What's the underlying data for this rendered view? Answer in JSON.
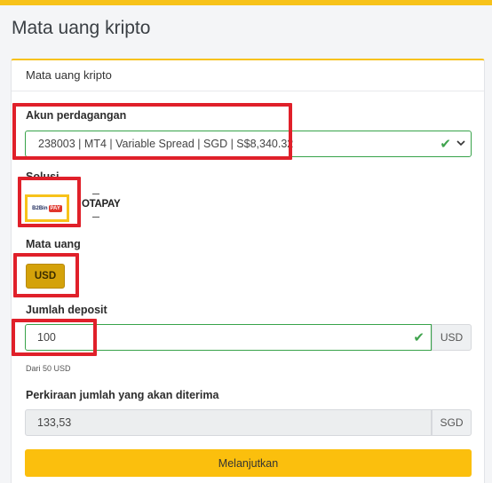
{
  "page": {
    "title": "Mata uang kripto"
  },
  "card": {
    "header": "Mata uang kripto"
  },
  "trading_account": {
    "label": "Akun perdagangan",
    "selected": "238003 | MT4 | Variable Spread | SGD | S$8,340.32"
  },
  "solution": {
    "label": "Solusi",
    "options": [
      {
        "name": "B2BinPay",
        "logo_text_1": "B2Bin",
        "logo_text_2": "PAY"
      },
      {
        "name": "OTAPAY",
        "logo_text": "OTAPAY"
      }
    ]
  },
  "currency": {
    "label": "Mata uang",
    "selected": "USD"
  },
  "deposit": {
    "label": "Jumlah deposit",
    "value": "100",
    "unit": "USD",
    "hint": "Dari 50 USD"
  },
  "estimate": {
    "label": "Perkiraan jumlah yang akan diterima",
    "value": "133,53",
    "unit": "SGD"
  },
  "submit": {
    "label": "Melanjutkan"
  },
  "colors": {
    "accent": "#f7c21a",
    "button": "#fbbf0d",
    "valid": "#38a34a",
    "highlight": "#e0202a"
  },
  "icons": {
    "valid": "check-icon",
    "dropdown": "chevron-down-icon"
  }
}
